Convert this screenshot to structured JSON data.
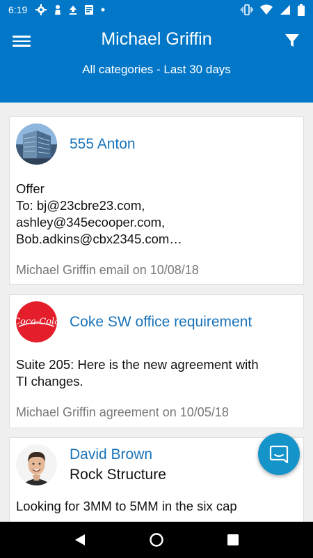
{
  "status_bar": {
    "time": "6:19",
    "icons": [
      "gear-icon",
      "chess-pawn-icon",
      "download-icon",
      "document-icon",
      "dot-icon"
    ],
    "right_icons": [
      "vibrate-icon",
      "wifi-icon",
      "signal-icon",
      "battery-icon"
    ]
  },
  "header": {
    "title": "Michael Griffin",
    "subtitle": "All categories - Last 30 days",
    "menu_icon": "menu-icon",
    "filter_icon": "filter-icon",
    "color": "#0277c8"
  },
  "feed": [
    {
      "title": "555 Anton",
      "body": [
        "Offer",
        "To: bj@23cbre23.com,",
        "ashley@345ecooper.com,",
        "Bob.adkins@cbx2345.com…"
      ],
      "meta": "Michael Griffin email on 10/08/18"
    },
    {
      "title": "Coke SW office requirement",
      "logo_text": "Coca-Cola",
      "body": [
        "Suite 205: Here is the new agreement with",
        "TI changes."
      ],
      "meta": "Michael Griffin agreement on 10/05/18"
    },
    {
      "name": "David Brown",
      "company": "Rock Structure",
      "body": [
        "Looking for 3MM to 5MM in the six cap"
      ]
    }
  ],
  "fab_icon": "chat-icon",
  "nav": [
    "back-icon",
    "home-icon",
    "recents-icon"
  ],
  "colors": {
    "accent": "#0277c8",
    "link": "#1a73b8",
    "fab": "#1594c9"
  }
}
